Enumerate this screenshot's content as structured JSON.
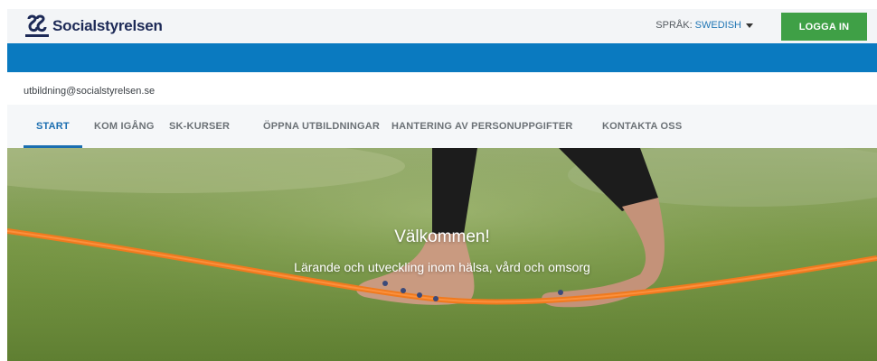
{
  "header": {
    "logo_text": "Socialstyrelsen",
    "language_label": "SPRÅK:",
    "language_value": "SWEDISH",
    "login_label": "LOGGA IN"
  },
  "contact_email": "utbildning@socialstyrelsen.se",
  "nav": {
    "items": [
      {
        "label": "START",
        "active": true
      },
      {
        "label": "KOM IGÅNG"
      },
      {
        "label": "SK-KURSER"
      },
      {
        "label": "ÖPPNA UTBILDNINGAR"
      },
      {
        "label": "HANTERING AV PERSONUPPGIFTER"
      },
      {
        "label": "KONTAKTA OSS"
      }
    ]
  },
  "hero": {
    "title": "Välkommen!",
    "subtitle": "Lärande och utveckling inom hälsa, vård och omsorg"
  },
  "colors": {
    "brand_blue": "#0a7ac0",
    "login_green": "#3fa046",
    "nav_active": "#1b6eb0",
    "logo_navy": "#1d2a57"
  },
  "icons": {
    "logo": "socialstyrelsen-logo-icon",
    "language_caret": "caret-down-icon"
  }
}
